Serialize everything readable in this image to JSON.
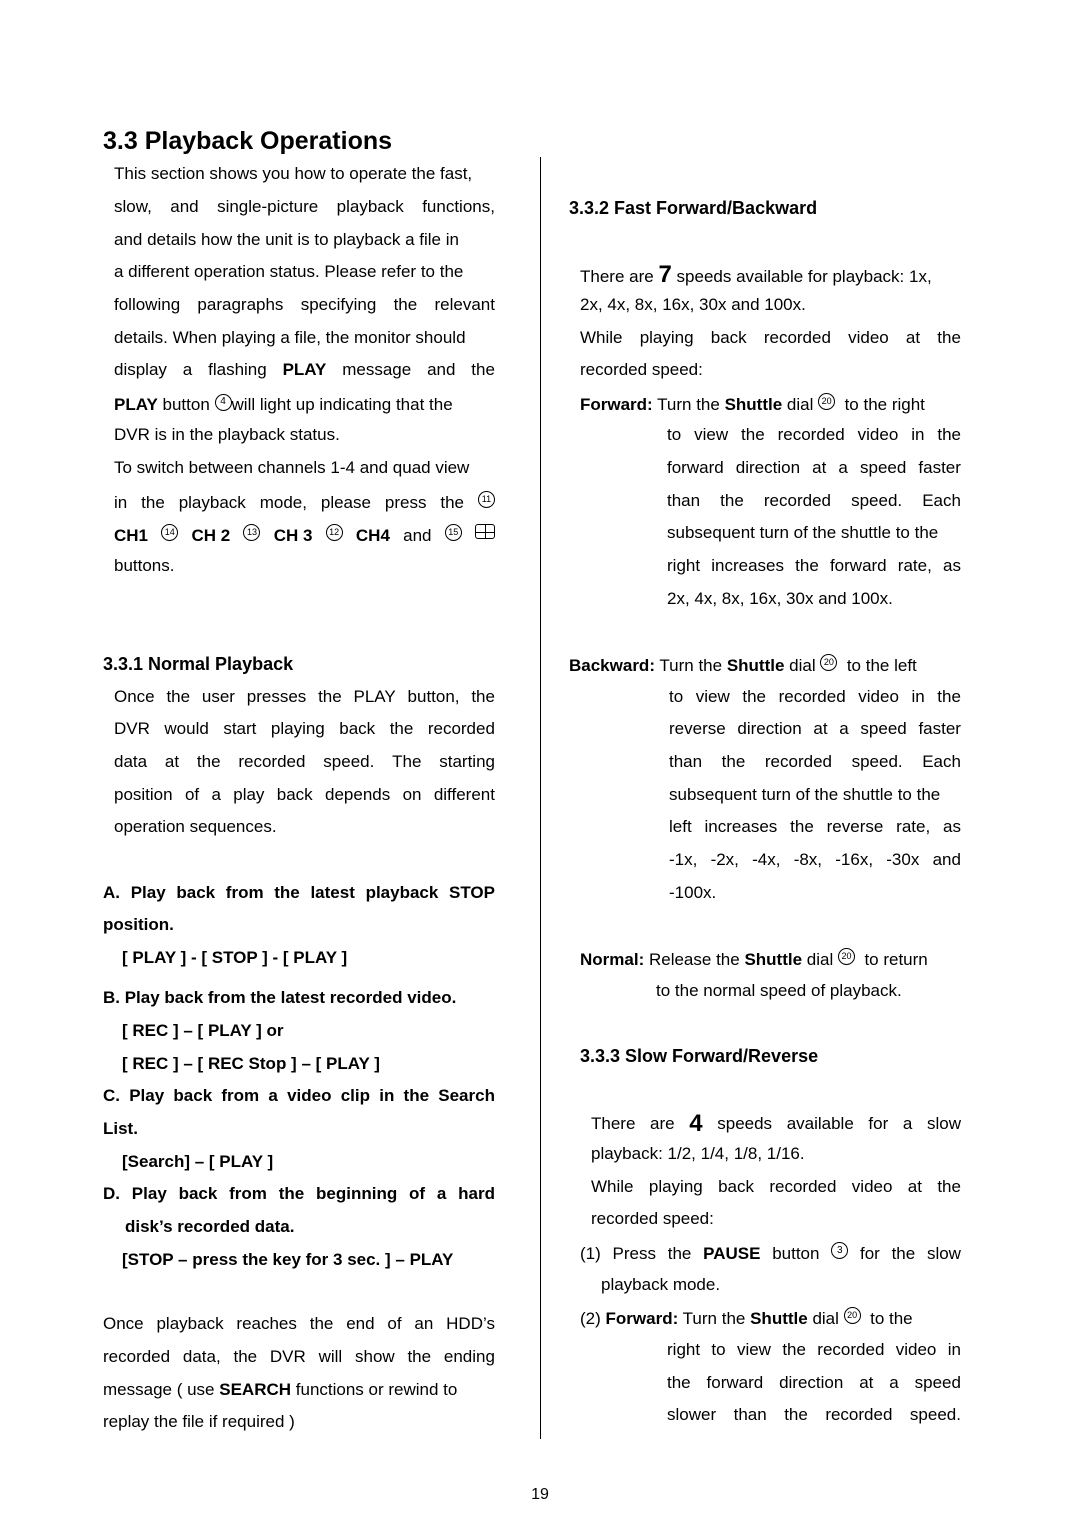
{
  "page": {
    "section_title": "3.3 Playback Operations",
    "page_number": "19"
  },
  "intro": {
    "lines": [
      "This section shows you how to operate the fast,",
      "slow, and single-picture playback functions,",
      "and details how the unit is to playback a file in",
      "a different operation status. Please refer to the",
      "following paragraphs specifying the relevant",
      "details. When playing a file, the monitor should"
    ],
    "line7_pre": "display a flashing",
    "line7_bold": "PLAY",
    "line7_post": "message and the",
    "line8_bold": "PLAY",
    "line8_mid": "button",
    "line8_btn": "4",
    "line8_post": "will light up indicating that the",
    "line9": "DVR is in the playback status.",
    "line10": "To switch between channels 1-4 and quad view",
    "line11_pre": "in the playback mode, please press the",
    "line11_btn": "11",
    "ch_line": {
      "ch1": "CH1",
      "ch1_btn": "14",
      "ch2": "CH 2",
      "ch2_btn": "13",
      "ch3": "CH 3",
      "ch3_btn": "12",
      "ch4": "CH4",
      "and": "and",
      "quad_btn": "15"
    },
    "line13": "buttons."
  },
  "normal_playback": {
    "heading": "3.3.1 Normal Playback",
    "lines": [
      "Once the user presses the PLAY button, the",
      "DVR would start playing back the recorded",
      "data at the recorded speed. The starting",
      "position of a play back depends on different",
      "operation sequences."
    ],
    "items": {
      "a_line1": "A. Play back from the latest playback STOP",
      "a_line2": "position.",
      "a_seq": "[ PLAY ] - [ STOP ] - [ PLAY ]",
      "b_line1": "B. Play back from the latest recorded video.",
      "b_seq1": "[ REC ] – [ PLAY ] or",
      "b_seq2": "[ REC ] – [ REC Stop ] – [ PLAY ]",
      "c_line1": "C. Play back from a video clip in the Search",
      "c_line2": "List.",
      "c_seq": "[Search] – [ PLAY ]",
      "d_line1": "D. Play back from the beginning of a hard",
      "d_line2": "disk’s recorded data.",
      "d_seq": "[STOP – press the key for 3 sec. ] – PLAY"
    },
    "end_lines": [
      "Once playback reaches the end of an HDD’s",
      "recorded data, the DVR will show the ending"
    ],
    "end_line3_pre": "message ( use",
    "end_line3_bold": "SEARCH",
    "end_line3_post": "functions or rewind to",
    "end_line4": "replay the file if required )"
  },
  "fast_forward": {
    "heading": "3.3.2 Fast Forward/Backward",
    "speeds_pre": "There are",
    "speeds_count": "7",
    "speeds_post": "speeds available for playback: 1x,",
    "speeds_line2": "2x, 4x, 8x, 16x, 30x and 100x.",
    "while_line1": "While playing back recorded video at the",
    "while_line2": "recorded speed:",
    "forward": {
      "label": "Forward:",
      "pre": "Turn the",
      "bold": "Shuttle",
      "mid": "dial",
      "btn": "20",
      "post": "to the right",
      "lines": [
        "to view the recorded video in the",
        "forward direction at a speed faster",
        "than the recorded speed. Each",
        "subsequent turn of the shuttle to the",
        "right increases the forward rate, as",
        "2x, 4x, 8x, 16x, 30x and 100x."
      ]
    },
    "backward": {
      "label": "Backward:",
      "pre": "Turn the",
      "bold": "Shuttle",
      "mid": "dial",
      "btn": "20",
      "post": "to the left",
      "lines": [
        "to view the recorded video in the",
        "reverse direction at a speed faster",
        "than the recorded speed. Each",
        "subsequent turn of the shuttle to the",
        "left increases the reverse rate, as",
        "-1x, -2x, -4x, -8x, -16x, -30x and",
        "-100x."
      ]
    },
    "normal": {
      "label": "Normal:",
      "pre": "Release the",
      "bold": "Shuttle",
      "mid": "dial",
      "btn": "20",
      "post": "to return",
      "line2": "to the normal speed of playback."
    }
  },
  "slow_forward": {
    "heading": "3.3.3 Slow Forward/Reverse",
    "speeds_pre": "There are",
    "speeds_count": "4",
    "speeds_post": "speeds available for a slow",
    "speeds_line2": "playback: 1/2, 1/4, 1/8, 1/16.",
    "while_line1": "While playing back recorded video at the",
    "while_line2": "recorded speed:",
    "step1": {
      "num": "(1)",
      "pre": "Press the",
      "bold": "PAUSE",
      "mid": "button",
      "btn": "3",
      "post": "for the slow",
      "line2": "playback mode."
    },
    "step2": {
      "num": "(2)",
      "label": "Forward:",
      "pre": "Turn the",
      "bold": "Shuttle",
      "mid": "dial",
      "btn": "20",
      "post": "to the",
      "lines": [
        "right to view the recorded video in",
        "the forward direction at a speed",
        "slower than the recorded speed."
      ]
    }
  }
}
